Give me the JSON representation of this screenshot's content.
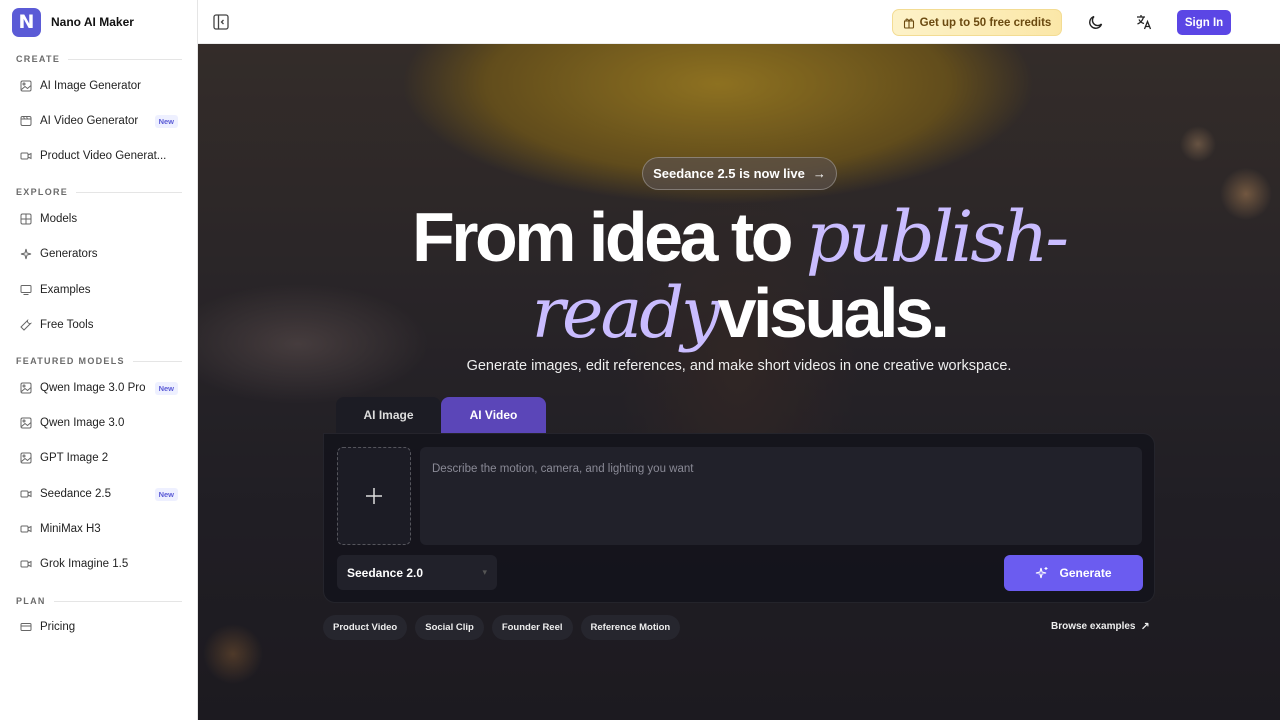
{
  "brand": {
    "logo_letter": "N",
    "name": "Nano AI Maker",
    "color": "#5b5bd6"
  },
  "sidebar": {
    "sections": {
      "create": "CREATE",
      "explore": "EXPLORE",
      "featured": "FEATURED MODELS",
      "plan": "PLAN"
    },
    "items": [
      {
        "label": "AI Image Generator",
        "icon": "image-icon"
      },
      {
        "label": "AI Video Generator",
        "icon": "video-icon",
        "badge": "New"
      },
      {
        "label": "Product Video Generat...",
        "icon": "video-icon"
      },
      {
        "label": "Models",
        "icon": "grid-icon"
      },
      {
        "label": "Generators",
        "icon": "sparkle-icon"
      },
      {
        "label": "Examples",
        "icon": "monitor-icon"
      },
      {
        "label": "Free Tools",
        "icon": "wrench-icon"
      },
      {
        "label": "Qwen Image 3.0 Pro",
        "icon": "image-icon",
        "badge": "New"
      },
      {
        "label": "Qwen Image 3.0",
        "icon": "image-icon"
      },
      {
        "label": "GPT Image 2",
        "icon": "image-icon"
      },
      {
        "label": "Seedance 2.5",
        "icon": "video-icon",
        "badge": "New"
      },
      {
        "label": "MiniMax H3",
        "icon": "video-icon"
      },
      {
        "label": "Grok Imagine 1.5",
        "icon": "video-icon"
      },
      {
        "label": "Pricing",
        "icon": "card-icon"
      }
    ]
  },
  "topbar": {
    "credits_label": "Get up to 50 free credits",
    "signin_label": "Sign In"
  },
  "hero": {
    "announcement": "Seedance 2.5 is now live",
    "headline": {
      "part1": "From idea to ",
      "italic1": "publish-",
      "italic2": "ready",
      "part2": "visuals."
    },
    "subtitle": "Generate images, edit references, and make short videos in one creative workspace.",
    "tabs": [
      {
        "label": "AI Image",
        "active": false
      },
      {
        "label": "AI Video",
        "active": true
      }
    ],
    "prompt_placeholder": "Describe the motion, camera, and lighting you want",
    "model_selected": "Seedance 2.0",
    "generate_label": "Generate",
    "chips": [
      "Product Video",
      "Social Clip",
      "Founder Reel",
      "Reference Motion"
    ],
    "browse_label": "Browse examples"
  },
  "colors": {
    "accent": "#5b46e5",
    "generate": "#6b5cf0",
    "italic_text": "#c9bcff",
    "credits_bg": "#fbe7a8"
  }
}
